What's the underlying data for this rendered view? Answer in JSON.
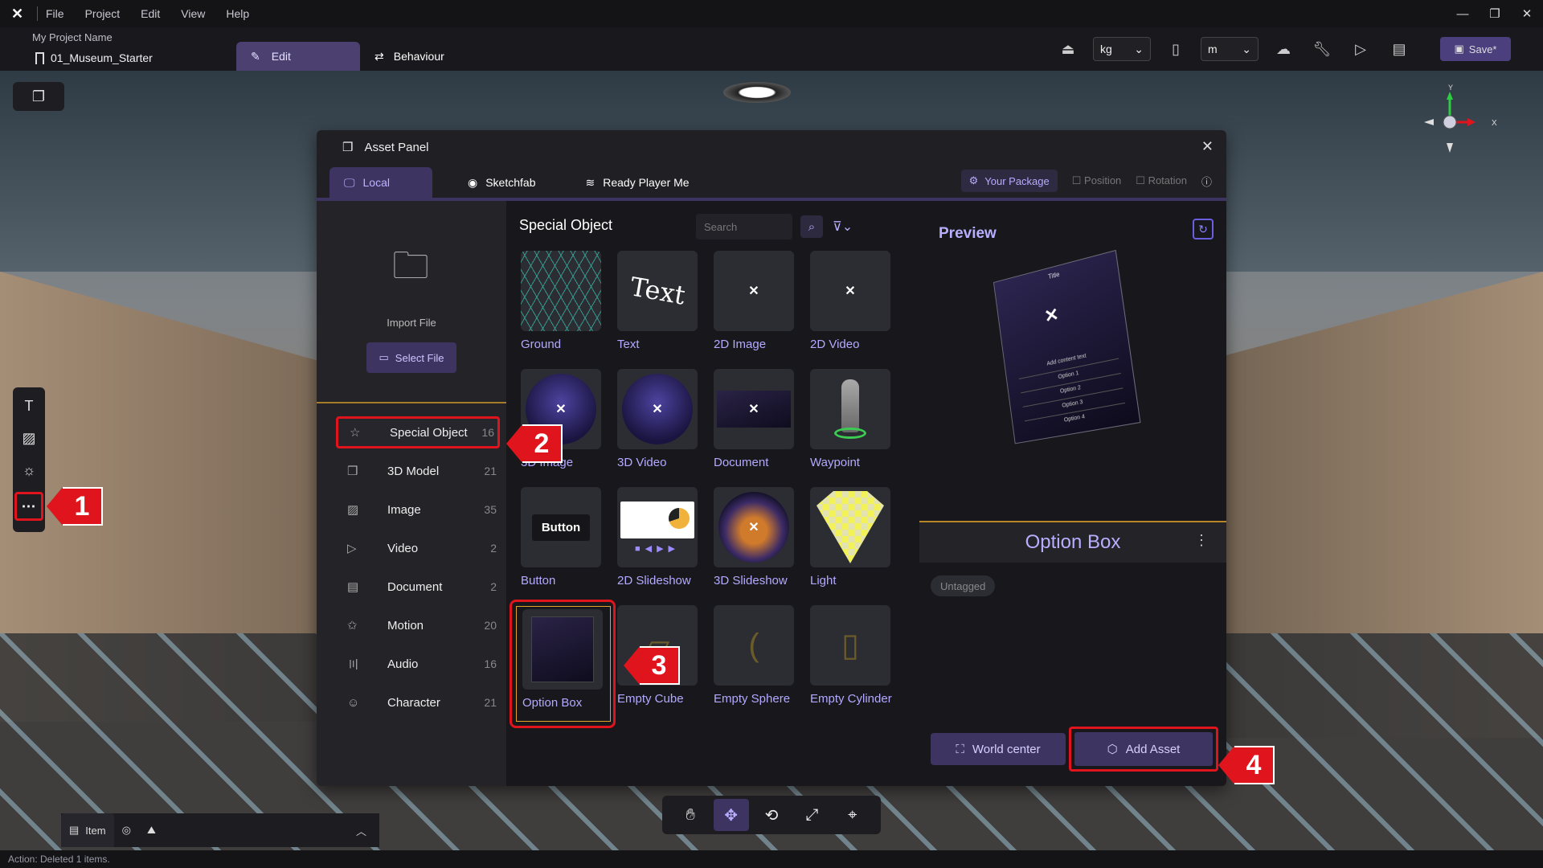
{
  "menu": {
    "logo": "✕",
    "items": [
      "File",
      "Project",
      "View",
      "Edit",
      "Help"
    ]
  },
  "window_controls": {
    "minimize": "—",
    "restore": "❐",
    "close": "✕"
  },
  "toolbar": {
    "project_name": "My Project Name",
    "file_name": "01_Museum_Starter",
    "tab_edit": "Edit",
    "tab_behaviour": "Behaviour",
    "mass_unit": "kg",
    "length_unit": "m",
    "save_label": "Save*"
  },
  "left_tools": {
    "more_glyph": "⋯"
  },
  "asset_panel": {
    "title": "Asset Panel",
    "close": "✕",
    "tabs": [
      {
        "label": "Local"
      },
      {
        "label": "Sketchfab"
      },
      {
        "label": "Ready Player Me"
      }
    ],
    "your_package": "Your Package",
    "position": "Position",
    "rotation": "Rotation",
    "import_label": "Import File",
    "select_file": "Select File",
    "categories": [
      {
        "label": "Special Object",
        "count": "16"
      },
      {
        "label": "3D Model",
        "count": "21"
      },
      {
        "label": "Image",
        "count": "35"
      },
      {
        "label": "Video",
        "count": "2"
      },
      {
        "label": "Document",
        "count": "2"
      },
      {
        "label": "Motion",
        "count": "20"
      },
      {
        "label": "Audio",
        "count": "16"
      },
      {
        "label": "Character",
        "count": "21"
      }
    ],
    "section_title": "Special Object",
    "search_placeholder": "Search",
    "items": [
      "Ground",
      "Text",
      "2D Image",
      "2D Video",
      "3D Image",
      "3D Video",
      "Document",
      "Waypoint",
      "Button",
      "2D Slideshow",
      "3D Slideshow",
      "Light",
      "Option Box",
      "Empty Cube",
      "Empty Sphere",
      "Empty Cylinder"
    ],
    "text_thumb": "Text",
    "button_thumb": "Button",
    "preview_title": "Preview",
    "preview_card": {
      "title": "Title",
      "add_text": "Add content text",
      "options": [
        "Option 1",
        "Option 2",
        "Option 3",
        "Option 4"
      ]
    },
    "selected_name": "Option Box",
    "tag": "Untagged",
    "world_center": "World center",
    "add_asset": "Add Asset"
  },
  "callouts": [
    "1",
    "2",
    "3",
    "4"
  ],
  "dock": {
    "item_tab": "Item"
  },
  "status": "Action: Deleted 1 items.",
  "colors": {
    "accent": "#3d3462",
    "accent_text": "#b8aeff",
    "highlight_red": "#e0141c"
  }
}
